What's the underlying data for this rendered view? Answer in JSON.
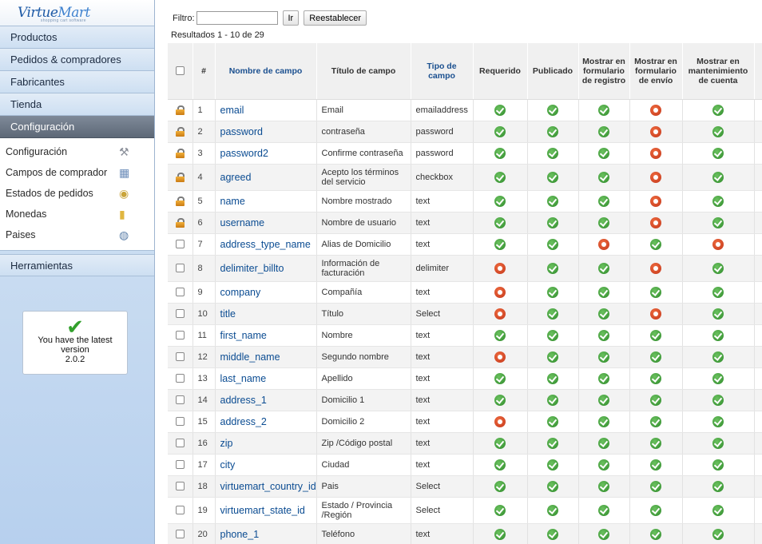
{
  "sidebar": {
    "logo": {
      "part1": "Virtue",
      "part2": "Mart",
      "tagline": "shopping cart software"
    },
    "menu": [
      {
        "label": "Productos"
      },
      {
        "label": "Pedidos & compradores"
      },
      {
        "label": "Fabricantes"
      },
      {
        "label": "Tienda"
      },
      {
        "label": "Configuración",
        "active": true
      }
    ],
    "submenu": [
      {
        "label": "Configuración",
        "icon": "tools-icon"
      },
      {
        "label": "Campos de comprador",
        "icon": "form-icon"
      },
      {
        "label": "Estados de pedidos",
        "icon": "status-icon"
      },
      {
        "label": "Monedas",
        "icon": "coins-icon"
      },
      {
        "label": "Paises",
        "icon": "globe-icon"
      }
    ],
    "tools": "Herramientas",
    "version": {
      "line1": "You have the latest",
      "line2": "version",
      "number": "2.0.2"
    }
  },
  "filter": {
    "label": "Filtro:",
    "value": "",
    "go": "Ir",
    "reset": "Reestablecer"
  },
  "results": "Resultados 1 - 10 de 29",
  "table": {
    "headers": {
      "num": "#",
      "name": "Nombre de campo",
      "title": "Título de campo",
      "type": "Tipo de campo",
      "required": "Requerido",
      "published": "Publicado",
      "registration": "Mostrar en formulario de registro",
      "shipping": "Mostrar en formulario de envío",
      "account": "Mostrar en mantenimiento de cuenta"
    },
    "rows": [
      {
        "locked": true,
        "num": "1",
        "name": "email",
        "title": "Email",
        "type": "emailaddress",
        "req": true,
        "pub": true,
        "reg": true,
        "ship": false,
        "acc": true
      },
      {
        "locked": true,
        "num": "2",
        "name": "password",
        "title": "contraseña",
        "type": "password",
        "req": true,
        "pub": true,
        "reg": true,
        "ship": false,
        "acc": true
      },
      {
        "locked": true,
        "num": "3",
        "name": "password2",
        "title": "Confirme contraseña",
        "type": "password",
        "req": true,
        "pub": true,
        "reg": true,
        "ship": false,
        "acc": true
      },
      {
        "locked": true,
        "num": "4",
        "name": "agreed",
        "title": "Acepto los términos del servicio",
        "type": "checkbox",
        "req": true,
        "pub": true,
        "reg": true,
        "ship": false,
        "acc": true
      },
      {
        "locked": true,
        "num": "5",
        "name": "name",
        "title": "Nombre mostrado",
        "type": "text",
        "req": true,
        "pub": true,
        "reg": true,
        "ship": false,
        "acc": true
      },
      {
        "locked": true,
        "num": "6",
        "name": "username",
        "title": "Nombre de usuario",
        "type": "text",
        "req": true,
        "pub": true,
        "reg": true,
        "ship": false,
        "acc": true
      },
      {
        "locked": false,
        "num": "7",
        "name": "address_type_name",
        "title": "Alias de Domicilio",
        "type": "text",
        "req": true,
        "pub": true,
        "reg": false,
        "ship": true,
        "acc": false
      },
      {
        "locked": false,
        "num": "8",
        "name": "delimiter_billto",
        "title": "Información de facturación",
        "type": "delimiter",
        "req": false,
        "pub": true,
        "reg": true,
        "ship": false,
        "acc": true
      },
      {
        "locked": false,
        "num": "9",
        "name": "company",
        "title": "Compañía",
        "type": "text",
        "req": false,
        "pub": true,
        "reg": true,
        "ship": true,
        "acc": true
      },
      {
        "locked": false,
        "num": "10",
        "name": "title",
        "title": "Título",
        "type": "Select",
        "req": false,
        "pub": true,
        "reg": true,
        "ship": false,
        "acc": true
      },
      {
        "locked": false,
        "num": "11",
        "name": "first_name",
        "title": "Nombre",
        "type": "text",
        "req": true,
        "pub": true,
        "reg": true,
        "ship": true,
        "acc": true
      },
      {
        "locked": false,
        "num": "12",
        "name": "middle_name",
        "title": "Segundo nombre",
        "type": "text",
        "req": false,
        "pub": true,
        "reg": true,
        "ship": true,
        "acc": true
      },
      {
        "locked": false,
        "num": "13",
        "name": "last_name",
        "title": "Apellido",
        "type": "text",
        "req": true,
        "pub": true,
        "reg": true,
        "ship": true,
        "acc": true
      },
      {
        "locked": false,
        "num": "14",
        "name": "address_1",
        "title": "Domicilio 1",
        "type": "text",
        "req": true,
        "pub": true,
        "reg": true,
        "ship": true,
        "acc": true
      },
      {
        "locked": false,
        "num": "15",
        "name": "address_2",
        "title": "Domicilio 2",
        "type": "text",
        "req": false,
        "pub": true,
        "reg": true,
        "ship": true,
        "acc": true
      },
      {
        "locked": false,
        "num": "16",
        "name": "zip",
        "title": "Zip /Código postal",
        "type": "text",
        "req": true,
        "pub": true,
        "reg": true,
        "ship": true,
        "acc": true
      },
      {
        "locked": false,
        "num": "17",
        "name": "city",
        "title": "Ciudad",
        "type": "text",
        "req": true,
        "pub": true,
        "reg": true,
        "ship": true,
        "acc": true
      },
      {
        "locked": false,
        "num": "18",
        "name": "virtuemart_country_id",
        "title": "Pais",
        "type": "Select",
        "req": true,
        "pub": true,
        "reg": true,
        "ship": true,
        "acc": true
      },
      {
        "locked": false,
        "num": "19",
        "name": "virtuemart_state_id",
        "title": "Estado / Provincia /Región",
        "type": "Select",
        "req": true,
        "pub": true,
        "reg": true,
        "ship": true,
        "acc": true
      },
      {
        "locked": false,
        "num": "20",
        "name": "phone_1",
        "title": "Teléfono",
        "type": "text",
        "req": true,
        "pub": true,
        "reg": true,
        "ship": true,
        "acc": true
      }
    ]
  }
}
